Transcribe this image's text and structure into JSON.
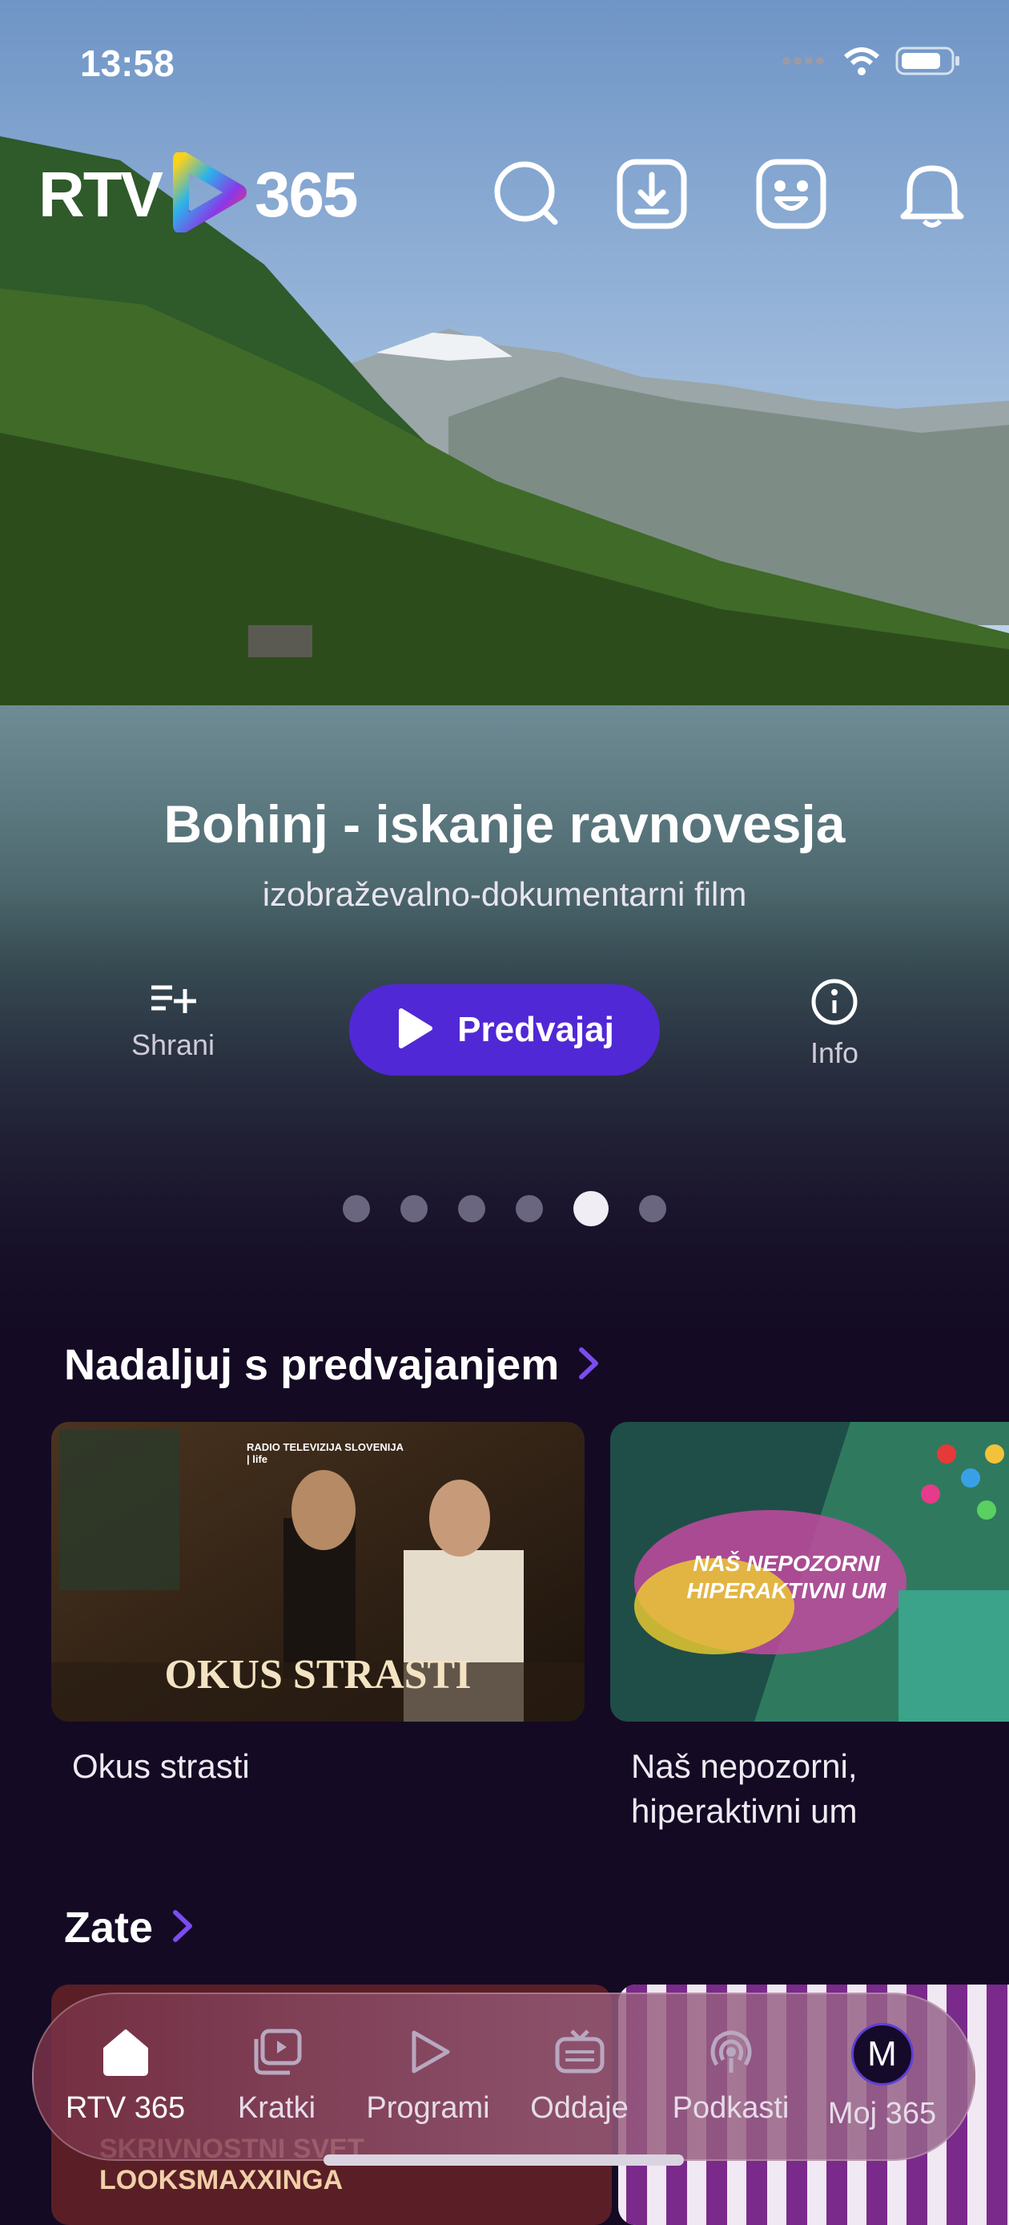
{
  "status": {
    "time": "13:58"
  },
  "brand": {
    "left": "RTV",
    "right": "365"
  },
  "header": {
    "icons": [
      "search-icon",
      "download-icon",
      "kids-face-icon",
      "bell-icon"
    ]
  },
  "hero": {
    "title": "Bohinj - iskanje ravnovesja",
    "subtitle": "izobraževalno-dokumentarni film",
    "save_label": "Shrani",
    "play_label": "Predvajaj",
    "info_label": "Info",
    "carousel": {
      "count": 6,
      "active_index": 4
    }
  },
  "continue_watching": {
    "title": "Nadaljuj s predvajanjem",
    "items": [
      {
        "label": "Okus strasti",
        "art_text": "OKUS STRASTI",
        "badge": "RADIO TELEVIZIJA SLOVENIJA | life"
      },
      {
        "label": "Naš nepozorni, hiperaktivni um",
        "art_text": "NAŠ NEPOZORNI HIPERAKTIVNI UM"
      }
    ]
  },
  "for_you": {
    "title": "Zate",
    "items": [
      {
        "label": "SKRIVNOSTNI SVET LOOKSMAXXINGA"
      },
      {
        "label": ""
      }
    ]
  },
  "bottom_nav": {
    "items": [
      {
        "label": "RTV 365",
        "icon": "home-icon",
        "active": true
      },
      {
        "label": "Kratki",
        "icon": "shorts-icon",
        "active": false
      },
      {
        "label": "Programi",
        "icon": "play-outline-icon",
        "active": false
      },
      {
        "label": "Oddaje",
        "icon": "tv-icon",
        "active": false
      },
      {
        "label": "Podkasti",
        "icon": "podcast-icon",
        "active": false
      },
      {
        "label": "Moj 365",
        "icon": "avatar",
        "avatar_letter": "M",
        "active": false
      }
    ]
  },
  "colors": {
    "accent": "#5128d6",
    "background": "#140a24"
  }
}
